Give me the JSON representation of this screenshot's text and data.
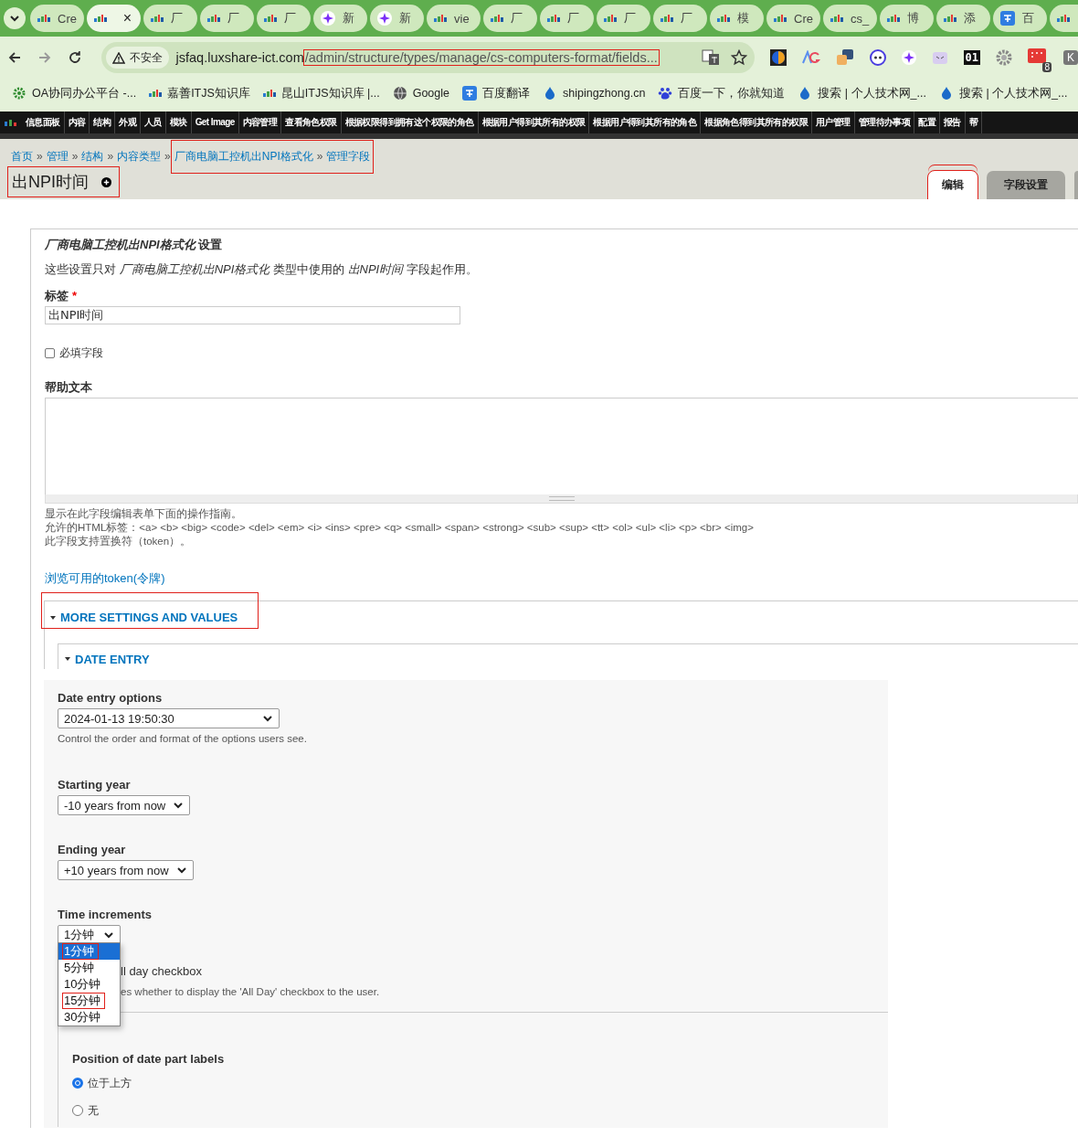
{
  "browser_tabs": {
    "tabs": [
      {
        "kind": "reic",
        "label": "Cre",
        "selected": false
      },
      {
        "kind": "reic",
        "selected": true,
        "close": "×"
      },
      {
        "kind": "reic",
        "label": "厂",
        "selected": false
      },
      {
        "kind": "reic",
        "label": "厂",
        "selected": false
      },
      {
        "kind": "reic",
        "label": "厂",
        "selected": false
      },
      {
        "kind": "sparkle",
        "label": "新",
        "selected": false
      },
      {
        "kind": "sparkle",
        "label": "新",
        "selected": false
      },
      {
        "kind": "reic",
        "label": "vie",
        "selected": false
      },
      {
        "kind": "reic",
        "label": "厂",
        "selected": false
      },
      {
        "kind": "reic",
        "label": "厂",
        "selected": false
      },
      {
        "kind": "reic",
        "label": "厂",
        "selected": false
      },
      {
        "kind": "reic",
        "label": "厂",
        "selected": false
      },
      {
        "kind": "reic",
        "label": "模",
        "selected": false
      },
      {
        "kind": "reic",
        "label": "Cre",
        "selected": false
      },
      {
        "kind": "reic",
        "label": "cs_",
        "selected": false
      },
      {
        "kind": "reic",
        "label": "博",
        "selected": false
      },
      {
        "kind": "reic",
        "label": "添",
        "selected": false
      },
      {
        "kind": "translate",
        "label": "百",
        "selected": false
      },
      {
        "kind": "reic",
        "selected": false
      }
    ]
  },
  "toolbar": {
    "security_label": "不安全",
    "url_host": "jsfaq.luxshare-ict.com",
    "url_path": "/admin/structure/types/manage/cs-computers-format/fields...",
    "url_path_highlighted": true,
    "extensions": [
      {
        "kind": "globe"
      },
      {
        "kind": "ag"
      },
      {
        "kind": "translate"
      },
      {
        "kind": "face"
      },
      {
        "kind": "sparkle"
      },
      {
        "kind": "cat"
      },
      {
        "kind": "text",
        "label": "01"
      },
      {
        "kind": "gear"
      },
      {
        "kind": "calendar",
        "badge": "8"
      },
      {
        "kind": "profile",
        "label": "K"
      }
    ]
  },
  "bookmarks": [
    {
      "kind": "gear",
      "label": "OA协同办公平台 -..."
    },
    {
      "kind": "reic",
      "label": "嘉善ITJS知识库"
    },
    {
      "kind": "reic",
      "label": "昆山ITJS知识库 |..."
    },
    {
      "kind": "globe",
      "label": "Google"
    },
    {
      "kind": "translate",
      "label": "百度翻译"
    },
    {
      "kind": "drop",
      "label": "shipingzhong.cn"
    },
    {
      "kind": "paw",
      "label": "百度一下，你就知道"
    },
    {
      "kind": "drop",
      "label": "搜索 | 个人技术网_..."
    },
    {
      "kind": "drop",
      "label": "搜索 | 个人技术网_..."
    }
  ],
  "admin_menu": [
    "信息面板",
    "内容",
    "结构",
    "外观",
    "人员",
    "模块",
    "Get Image",
    "内容管理",
    "查看角色权限",
    "根据权限得到拥有这个权限的角色",
    "根据用户得到其所有的权限",
    "根据用户得到其所有的角色",
    "根据角色得到其所有的权限",
    "用户管理",
    "管理待办事项",
    "配置",
    "报告",
    "帮"
  ],
  "page_header": {
    "breadcrumb": [
      "首页",
      "管理",
      "结构",
      "内容类型"
    ],
    "annotated_breadcrumb": [
      "厂商电脑工控机出NPI格式化",
      "管理字段"
    ],
    "separator": "»",
    "title": "出NPI时间",
    "title_highlighted": true,
    "tabs": [
      {
        "label": "编辑",
        "selected": true,
        "highlighted": true
      },
      {
        "label": "字段设置",
        "selected": false,
        "highlighted": false
      }
    ]
  },
  "form": {
    "heading": "*厂商电脑工控机出NPI格式化* 设置",
    "description": "这些设置只对 *厂商电脑工控机出NPI格式化* 类型中使用的 *出NPI时间* 字段起作用。",
    "label_field": {
      "label": "标签",
      "required": true,
      "required_mark": "*",
      "value": "出NPI时间"
    },
    "required_field": {
      "label": "必填字段",
      "checked": false
    },
    "help_text": {
      "label": "帮助文本"
    },
    "help_description": [
      "显示在此字段编辑表单下面的操作指南。",
      "允许的HTML标签：<a> <b> <big> <code> <del> <em> <i> <ins> <pre> <q> <small> <span> <strong> <sub> <sup> <tt> <ol> <ul> <li> <p> <br> <img>",
      "此字段支持置换符（token）。"
    ],
    "token_link": "浏览可用的token(令牌)",
    "more_settings": {
      "legend": "MORE SETTINGS AND VALUES",
      "expanded": true,
      "highlighted": true
    },
    "date_entry": {
      "legend": "DATE ENTRY",
      "expanded": true
    }
  },
  "date_panel": {
    "date_entry_options": {
      "label": "Date entry options",
      "value": "2024-01-13 19:50:30",
      "description": "Control the order and format of the options users see."
    },
    "starting_year": {
      "label": "Starting year",
      "value": "-10 years from now"
    },
    "ending_year": {
      "label": "Ending year",
      "value": "+10 years from now"
    },
    "time_increments": {
      "label": "Time increments",
      "value": "1分钟",
      "open": true,
      "options": [
        {
          "label": "1分钟",
          "selected": true,
          "highlighted": true
        },
        {
          "label": "5分钟",
          "selected": false,
          "highlighted": false
        },
        {
          "label": "10分钟",
          "selected": false,
          "highlighted": false
        },
        {
          "label": "15分钟",
          "selected": false,
          "highlighted": true
        },
        {
          "label": "30分钟",
          "selected": false,
          "highlighted": false
        }
      ]
    },
    "all_day": {
      "label": "ll day checkbox",
      "description": "es whether to display the 'All Day' checkbox to the user."
    },
    "date_part_labels": {
      "label": "Position of date part labels",
      "options": [
        {
          "label": "位于上方",
          "selected": true
        },
        {
          "label": "无",
          "selected": false
        }
      ]
    }
  }
}
